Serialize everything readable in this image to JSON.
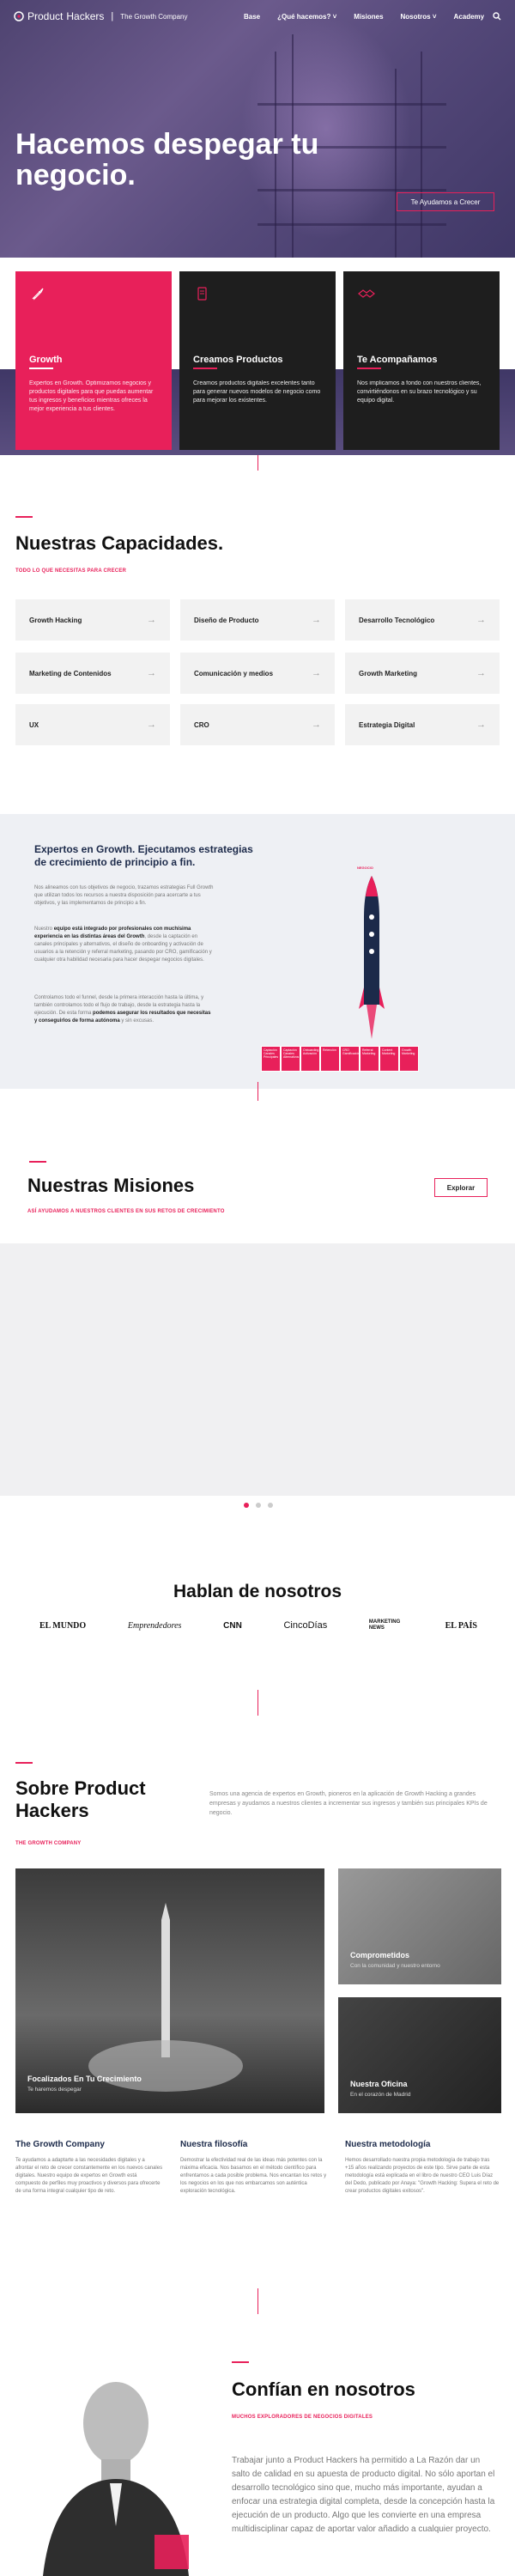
{
  "colors": {
    "accent": "#e8205a",
    "dark": "#222222",
    "navy": "#1c2a4a"
  },
  "nav": {
    "logo_a": "Product",
    "logo_b": "Hackers",
    "tagline": "The Growth Company",
    "items": [
      "Base",
      "¿Qué hacemos?",
      "Misiones",
      "Nosotros",
      "Academy"
    ]
  },
  "hero": {
    "title": "Hacemos despegar tu negocio.",
    "button": "Te Ayudamos a Crecer"
  },
  "cards": [
    {
      "icon": "rocket-icon",
      "title": "Growth",
      "text": "Expertos en Growth. Optimizamos negocios y productos digitales para que puedas aumentar tus ingresos y beneficios mientras ofreces la mejor experiencia a tus clientes."
    },
    {
      "icon": "mobile-icon",
      "title": "Creamos Productos",
      "text": "Creamos productos digitales excelentes tanto para generar nuevos modelos de negocio como para mejorar los existentes."
    },
    {
      "icon": "handshake-icon",
      "title": "Te Acompañamos",
      "text": "Nos implicamos a fondo con nuestros clientes, convirtiéndonos en su brazo tecnológico y su equipo digital."
    }
  ],
  "capacidades": {
    "title": "Nuestras Capacidades.",
    "subtitle": "TODO LO QUE NECESITAS PARA CRECER",
    "items": [
      "Growth Hacking",
      "Diseño de Producto",
      "Desarrollo Tecnológico",
      "Marketing de Contenidos",
      "Comunicación y medios",
      "Growth Marketing",
      "UX",
      "CRO",
      "Estrategia Digital"
    ]
  },
  "expertos": {
    "title": "Expertos en Growth. Ejecutamos estrategias de crecimiento de principio a fin.",
    "p1": "Nos alineamos con tus objetivos de negocio, trazamos estrategias Full Growth que utilizan todos los recursos a nuestra disposición para acercarte a tus objetivos, y las implementamos de principio a fin.",
    "p2a": "Nuestro ",
    "p2b": "equipo está integrado por profesionales con muchísima experiencia en las distintas áreas del Growth",
    "p2c": ", desde la captación en canales principales y alternativos, el diseño de onboarding y activación de usuarios a la retención y referral marketing, pasando por CRO, gamificación y cualquier otra habilidad necesaria para hacer despegar negocios digitales.",
    "p3a": "Controlamos todo el funnel, desde la primera interacción hasta la última, y también controlamos todo el flujo de trabajo, desde la estrategia hasta la ejecución. De esta forma ",
    "p3b": "podemos asegurar los resultados que necesitas y conseguirlos de forma autónoma",
    "p3c": " y sin excusas.",
    "rocket_label": "NEGOCIO",
    "table": [
      "Captación Canales Principales",
      "Captación Canales Alternativos",
      "Onboarding Activación",
      "Retención",
      "CRO Gamificación",
      "Referral Marketing",
      "Content Marketing",
      "Growth Marketing"
    ]
  },
  "misiones": {
    "title": "Nuestras Misiones",
    "subtitle": "ASÍ AYUDAMOS A NUESTROS CLIENTES EN SUS RETOS DE CRECIMIENTO",
    "button": "Explorar"
  },
  "prensa": {
    "title": "Hablan de nosotros",
    "logos": [
      "EL MUNDO",
      "Emprendedores",
      "CNN",
      "CincoDías",
      "MARKETING NEWS",
      "EL PAÍS"
    ]
  },
  "sobre": {
    "title": "Sobre Product Hackers",
    "subtitle": "THE GROWTH COMPANY",
    "intro": "Somos una agencia de expertos en Growth, pioneros en la aplicación de Growth Hacking a grandes empresas y ayudamos a nuestros clientes a incrementar sus ingresos y también sus principales KPIs de negocio.",
    "photos": [
      {
        "title": "Focalizados En Tu Crecimiento",
        "sub": "Te haremos despegar"
      },
      {
        "title": "Comprometidos",
        "sub": "Con la comunidad y nuestro entorno"
      },
      {
        "title": "Nuestra Oficina",
        "sub": "En el corazón de Madrid"
      }
    ],
    "cols": [
      {
        "title": "The Growth Company",
        "text": "Te ayudamos a adaptarte a las necesidades digitales y a afrontar el reto de crecer constantemente en los nuevos canales digitales. Nuestro equipo de expertos en Growth está compuesto de perfiles muy proactivos y diversos para ofrecerte de una forma integral cualquier tipo de reto."
      },
      {
        "title": "Nuestra filosofía",
        "text": "Demostrar la efectividad real de las ideas más potentes con la máxima eficacia. Nos basamos en el método científico para enfrentarnos a cada posible problema. Nos encantan los retos y los negocios en los que nos embarcamos son auténtica exploración tecnológica."
      },
      {
        "title": "Nuestra metodología",
        "text": "Hemos desarrollado nuestra propia metodología de trabajo tras +15 años realizando proyectos de este tipo. Sirve parte de esta metodología está explicada en el libro de nuestro CEO Luis Díaz del Dedo, publicado por Anaya: \"Growth Hacking: Supera el reto de crear productos digitales exitosos\"."
      }
    ]
  },
  "confian": {
    "title": "Confían en nosotros",
    "subtitle": "MUCHOS EXPLORADORES DE NEGOCIOS DIGITALES",
    "quote": "Trabajar junto a Product Hackers ha permitido a La Razón dar un salto de calidad en su apuesta de producto digital. No sólo aportan el desarrollo tecnológico sino que, mucho más importante, ayudan a enfocar una estrategia digital completa, desde la concepción hasta la ejecución de un producto. Algo que les convierte en una empresa multidisciplinar capaz de aportar valor añadido a cualquier proyecto."
  }
}
